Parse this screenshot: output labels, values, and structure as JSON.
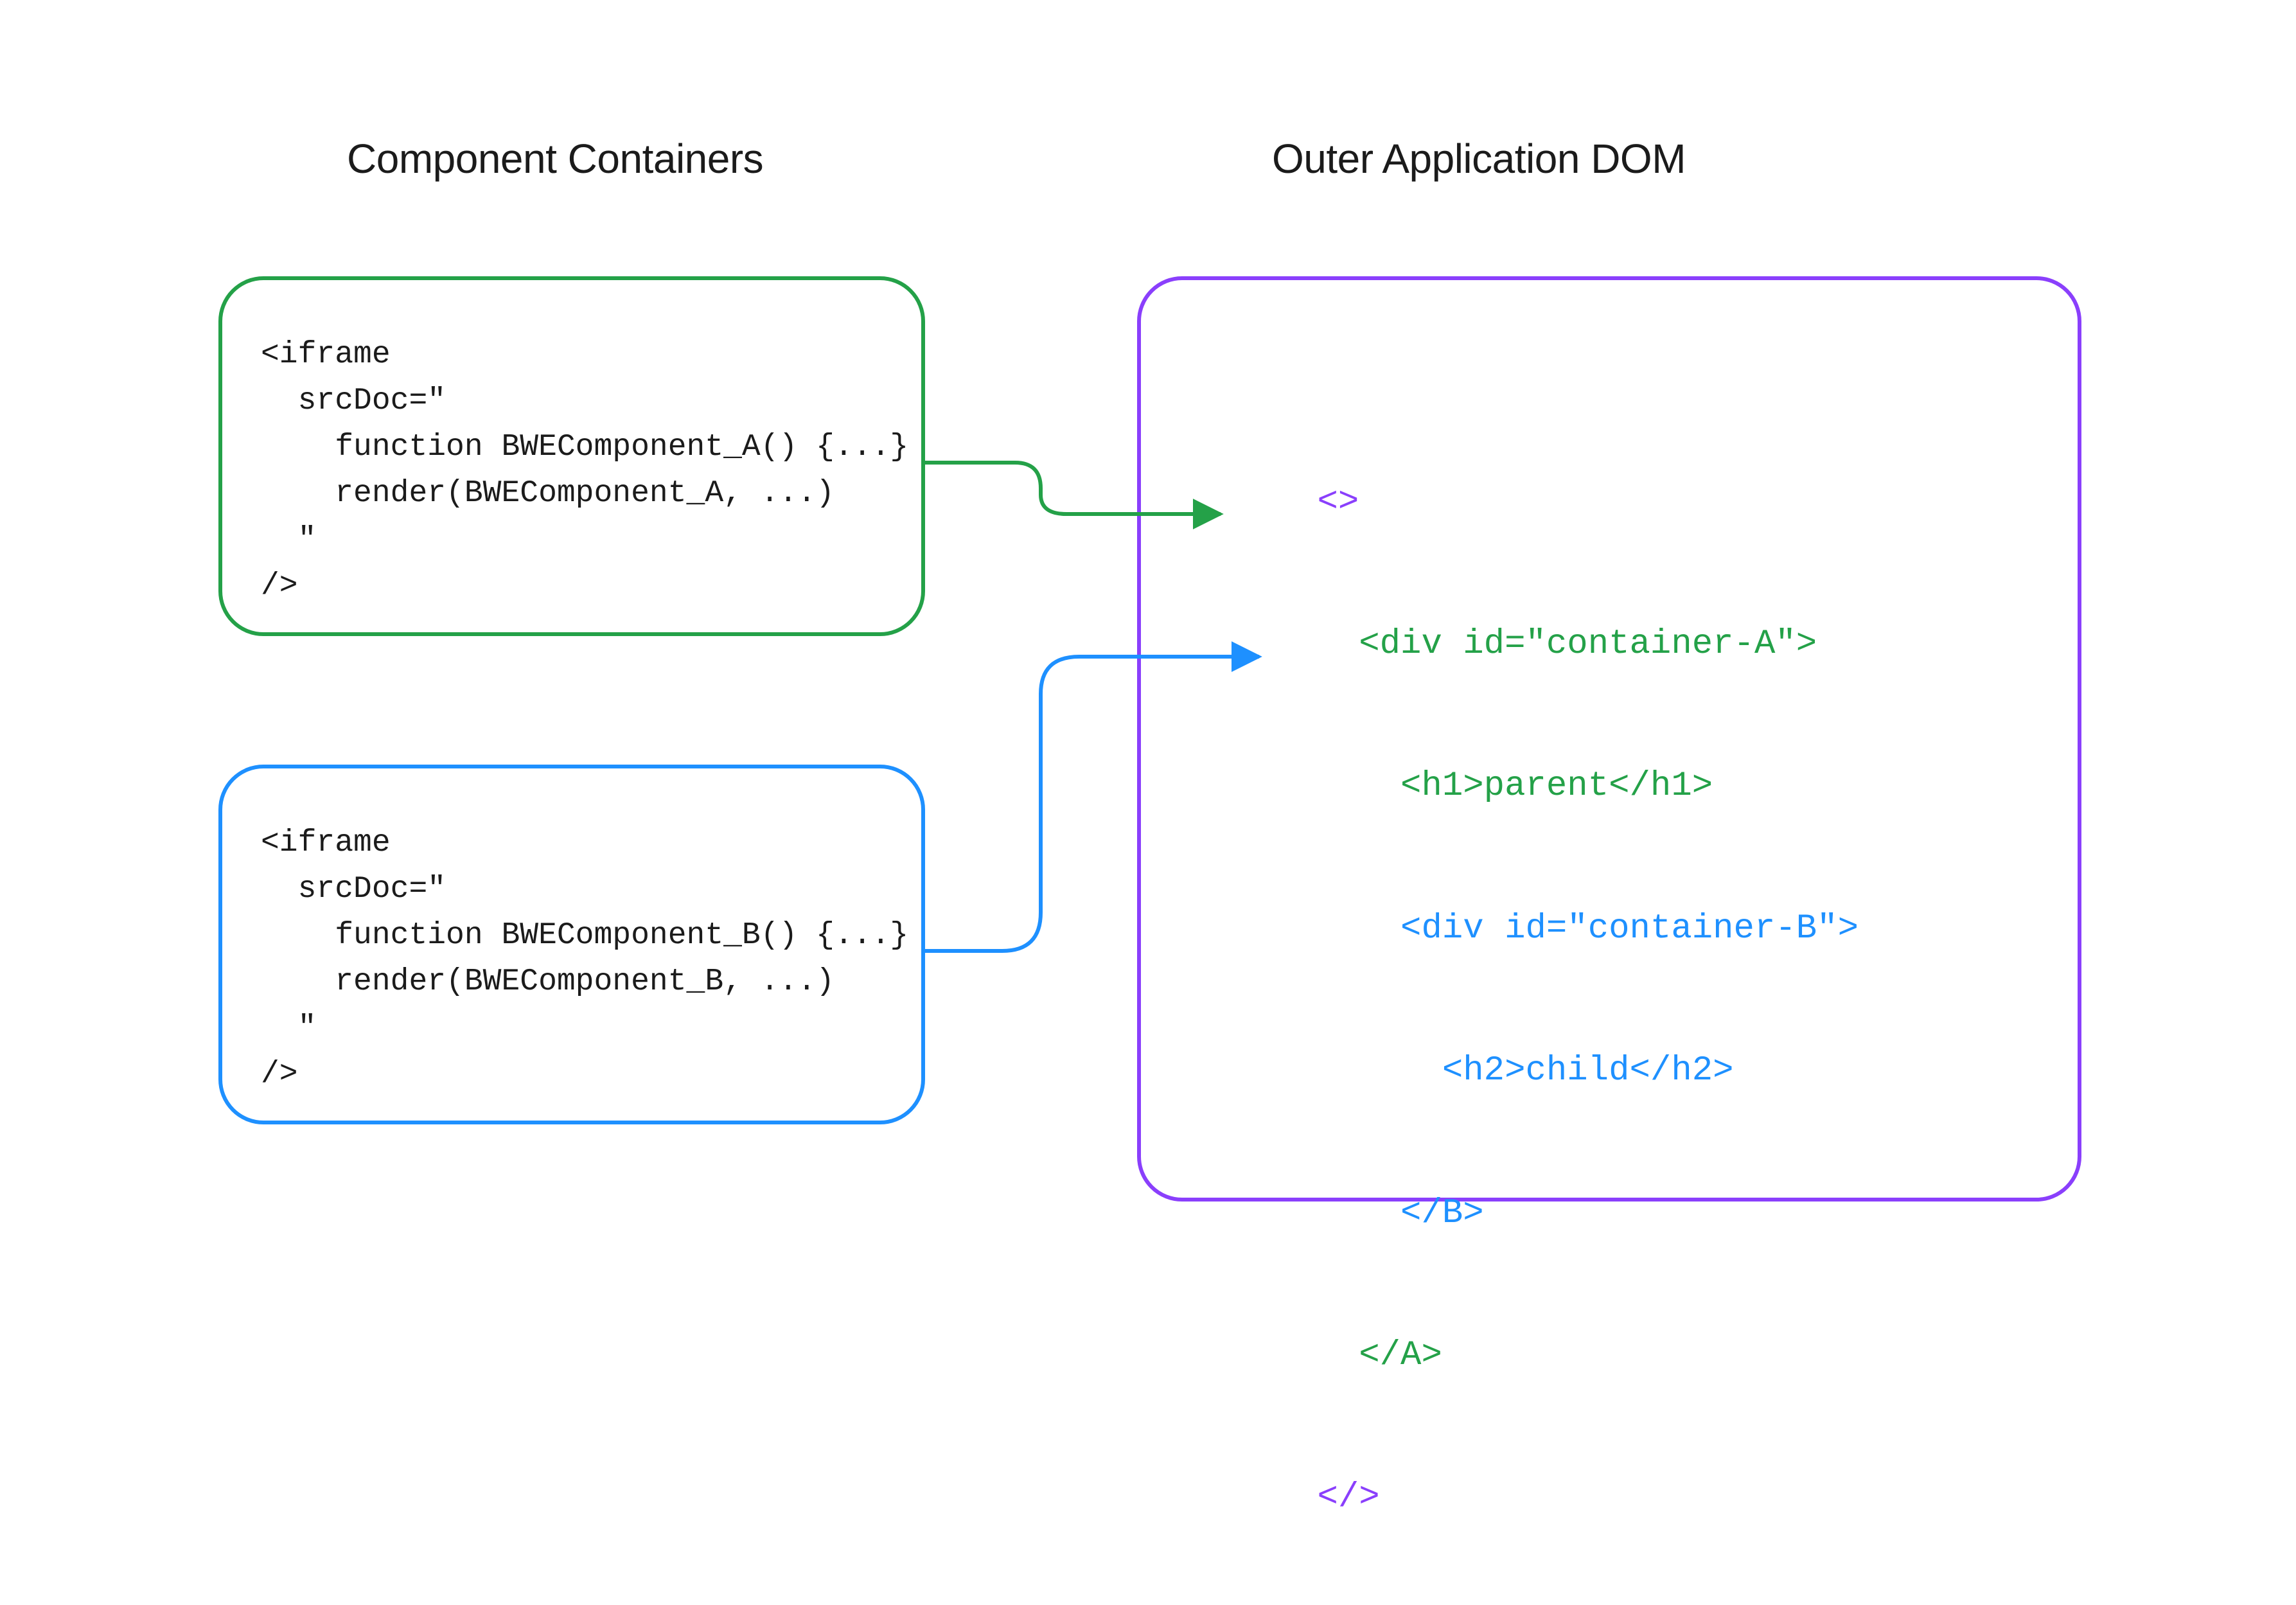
{
  "headings": {
    "left": "Component Containers",
    "right": "Outer Application DOM"
  },
  "containers": {
    "a": {
      "code": "<iframe\n  srcDoc=\"\n    function BWEComponent_A() {...}\n    render(BWEComponent_A, ...)\n  \"\n/>"
    },
    "b": {
      "code": "<iframe\n  srcDoc=\"\n    function BWEComponent_B() {...}\n    render(BWEComponent_B, ...)\n  \"\n/>"
    }
  },
  "dom": {
    "open_frag": "<>",
    "a_open": "  <div id=\"container-A\">",
    "a_h1": "    <h1>parent</h1>",
    "b_open": "    <div id=\"container-B\">",
    "b_h2": "      <h2>child</h2>",
    "b_close": "    </B>",
    "a_close": "  </A>",
    "close_frag": "</>"
  },
  "colors": {
    "green": "#24a148",
    "blue": "#1e90ff",
    "purple": "#8a3ffc",
    "text": "#1b1b1b"
  }
}
